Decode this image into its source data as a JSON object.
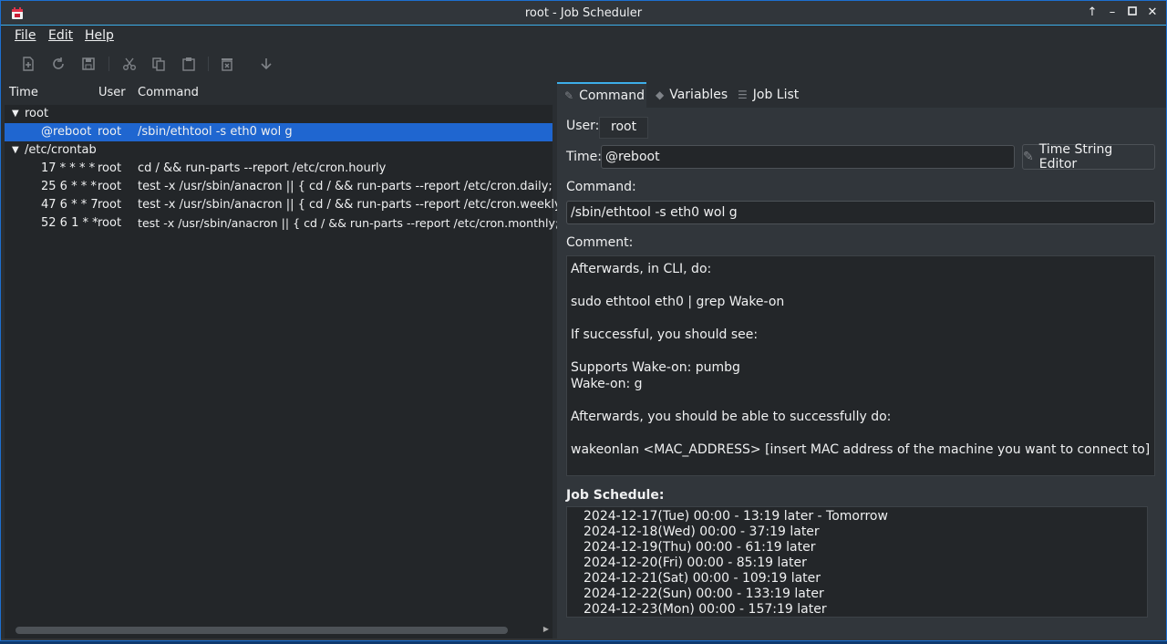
{
  "window": {
    "title": "root - Job Scheduler",
    "accent": "#3daee9",
    "selection": "#1f66d0"
  },
  "menu": {
    "file": "File",
    "edit": "Edit",
    "help": "Help"
  },
  "toolbar": {
    "icons": [
      "new-icon",
      "refresh-icon",
      "save-icon",
      "cut-icon",
      "copy-icon",
      "paste-icon",
      "delete-icon",
      "move-down-icon"
    ]
  },
  "jobs": {
    "headers": {
      "time": "Time",
      "user": "User",
      "command": "Command"
    },
    "groups": [
      {
        "name": "root",
        "rows": [
          {
            "time": "@reboot",
            "user": "root",
            "command": "/sbin/ethtool -s eth0 wol g",
            "selected": true
          }
        ]
      },
      {
        "name": "/etc/crontab",
        "rows": [
          {
            "time": "17 * * * *",
            "user": "root",
            "command": "cd / && run-parts --report /etc/cron.hourly"
          },
          {
            "time": "25 6 * * *",
            "user": "root",
            "command": "test -x /usr/sbin/anacron || { cd / && run-parts --report /etc/cron.daily; }"
          },
          {
            "time": "47 6 * * 7",
            "user": "root",
            "command": "test -x /usr/sbin/anacron || { cd / && run-parts --report /etc/cron.weekly; }"
          },
          {
            "time": "52 6 1 * *",
            "user": "root",
            "command": "test -x /usr/sbin/anacron || { cd / && run-parts --report /etc/cron.monthly; }"
          }
        ]
      }
    ]
  },
  "tabs": {
    "command": "Command",
    "variables": "Variables",
    "joblist": "Job List"
  },
  "editor": {
    "user_label": "User:",
    "user_value": "root",
    "time_label": "Time:",
    "time_value": "@reboot",
    "time_string_editor": "Time String Editor",
    "command_label": "Command:",
    "command_value": "/sbin/ethtool -s eth0 wol g",
    "comment_label": "Comment:",
    "comment_lines": [
      "Afterwards, in CLI, do:",
      "",
      "sudo ethtool eth0 | grep Wake-on",
      "",
      "If successful, you should see:",
      "",
      "Supports Wake-on: pumbg",
      "Wake-on: g",
      "",
      "Afterwards, you should be able to successfully do:",
      "",
      "wakeonlan <MAC_ADDRESS> [insert MAC address of the machine you want to connect to]"
    ],
    "schedule_label": "Job Schedule:",
    "schedule": [
      "2024-12-17(Tue) 00:00 - 13:19 later - Tomorrow",
      "2024-12-18(Wed) 00:00 - 37:19 later",
      "2024-12-19(Thu) 00:00 - 61:19 later",
      "2024-12-20(Fri) 00:00 - 85:19 later",
      "2024-12-21(Sat) 00:00 - 109:19 later",
      "2024-12-22(Sun) 00:00 - 133:19 later",
      "2024-12-23(Mon) 00:00 - 157:19 later"
    ]
  }
}
